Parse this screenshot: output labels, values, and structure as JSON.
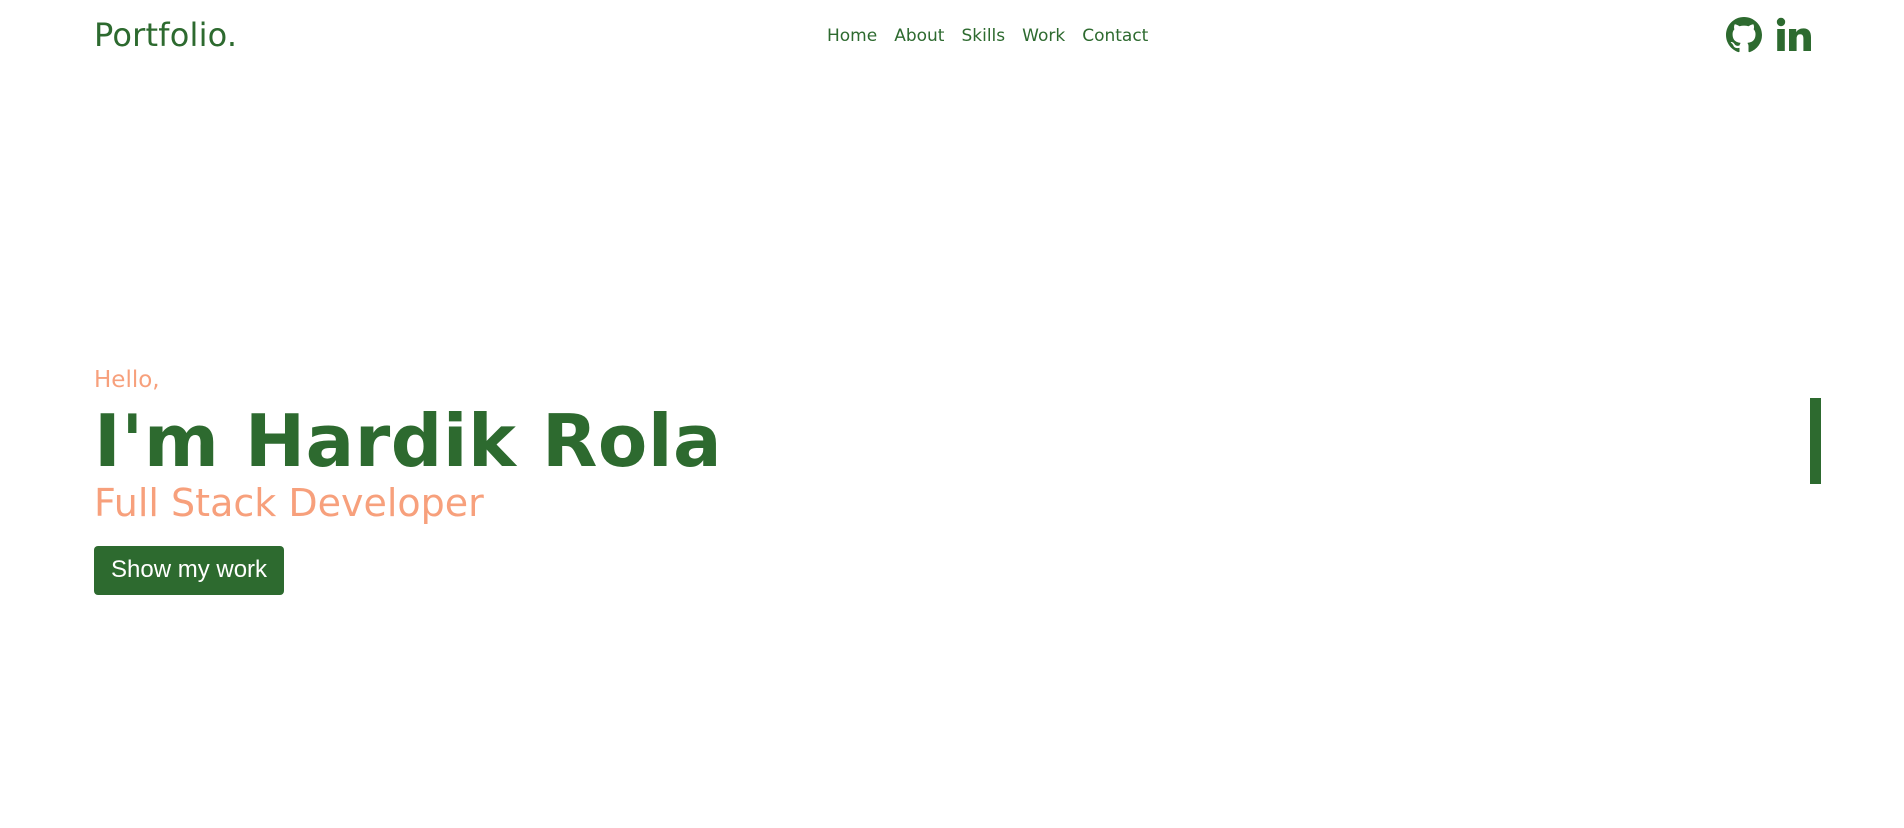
{
  "brand": {
    "logo_text": "Portfolio."
  },
  "nav": {
    "items": [
      {
        "label": "Home"
      },
      {
        "label": "About"
      },
      {
        "label": "Skills"
      },
      {
        "label": "Work"
      },
      {
        "label": "Contact"
      }
    ]
  },
  "socials": {
    "github_icon": "github-icon",
    "linkedin_icon": "linkedin-icon"
  },
  "hero": {
    "greeting": "Hello,",
    "name": "I'm Hardik Rola",
    "role": "Full Stack Developer",
    "cta_label": "Show my work"
  },
  "colors": {
    "primary": "#2d6a2f",
    "accent": "#f7a07c",
    "background": "#ffffff",
    "button_text": "#ffffff"
  }
}
